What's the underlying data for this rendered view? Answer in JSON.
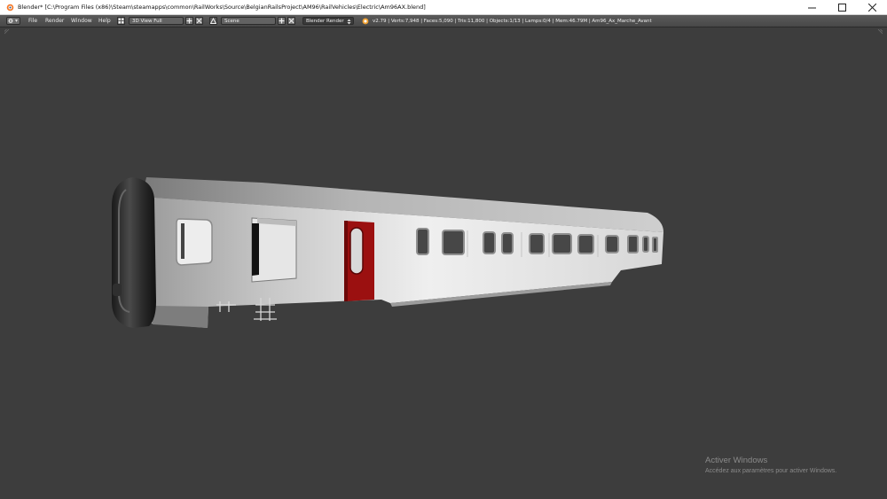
{
  "window": {
    "title": "Blender* [C:\\Program Files (x86)\\Steam\\steamapps\\common\\RailWorks\\Source\\BelgianRailsProject\\AM96\\RailVehicles\\Electric\\Am96AX.blend]"
  },
  "header": {
    "menus": [
      "File",
      "Render",
      "Window",
      "Help"
    ],
    "screen_layout": "3D View Full",
    "scene": "Scene",
    "render_engine": "Blender Render",
    "stats": "v2.79 | Verts:7,948 | Faces:5,090 | Tris:11,800 | Objects:1/13 | Lamps:0/4 | Mem:46.79M | Am96_Ax_Marche_Avant",
    "accent_color": "#f0a030"
  },
  "watermark": {
    "title": "Activer Windows",
    "subtitle": "Accédez aux paramètres pour activer Windows."
  },
  "colors": {
    "viewport_bg": "#3d3d3d",
    "header_bg": "#4f4f4f",
    "door_red": "#9b1010"
  }
}
